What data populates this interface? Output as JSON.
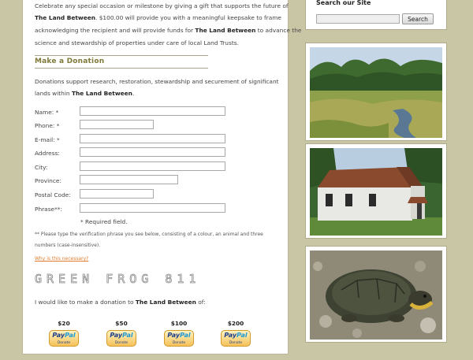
{
  "intro": {
    "line1": "Celebrate any special occasion or milestone by giving a gift that supports the future of",
    "org_name": "The Land Between",
    "line2_rest": ". $100.00 will provide you with a meaningful keepsake to frame",
    "line3_a": "acknowledging the recipient and will provide funds for ",
    "line3_rest": " to advance the",
    "line4": "science and stewardship of properties under care of local Land Trusts."
  },
  "donation": {
    "heading": "Make a Donation",
    "desc_line1": "Donations support research, restoration, stewardship and securement of significant",
    "desc_line2_a": "lands within ",
    "desc_line2_end": "."
  },
  "form": {
    "fields": [
      {
        "label": "Name: *",
        "value": ""
      },
      {
        "label": "Phone: *",
        "value": ""
      },
      {
        "label": "E-mail: *",
        "value": ""
      },
      {
        "label": "Address:",
        "value": ""
      },
      {
        "label": "City:",
        "value": ""
      },
      {
        "label": "Province:",
        "value": ""
      },
      {
        "label": "Postal Code:",
        "value": ""
      },
      {
        "label": "Phrase**:",
        "value": ""
      }
    ],
    "required_note": "* Required field.",
    "phrase_note_line1": "** Please type the verification phrase you see below, consisting of a colour, an animal and three",
    "phrase_note_line2": "numbers (case-insensitive).",
    "why_link": "Why is this necessary?",
    "captcha": "GREEN FROG 811"
  },
  "donate": {
    "intro_a": "I would like to make a donation to ",
    "intro_end": " of:",
    "amounts": [
      "$20",
      "$50",
      "$100",
      "$200"
    ],
    "paypal_word_a": "Pay",
    "paypal_word_b": "Pal",
    "paypal_sub": "Donate"
  },
  "sidebar": {
    "search_title": "Search our Site",
    "search_value": "",
    "search_button": "Search"
  },
  "colors": {
    "background": "#c9c6a6",
    "heading": "#7f7a3a",
    "link": "#e07b2f",
    "paypal_blue": "#1c3f8c"
  }
}
